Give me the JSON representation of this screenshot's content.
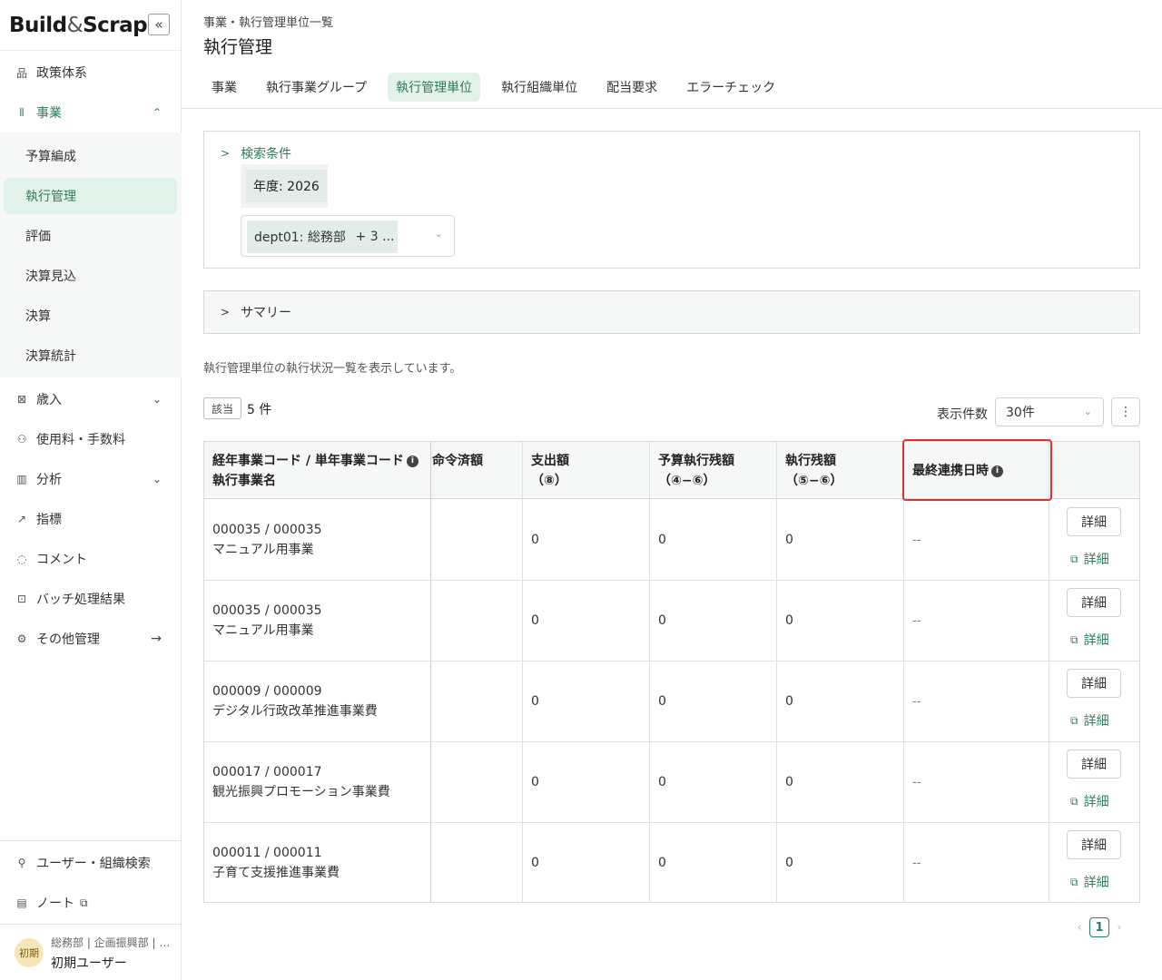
{
  "app": {
    "logo_main": "Build",
    "logo_amp": "&",
    "logo_end": "Scrap",
    "collapse_icon": "«"
  },
  "sidebar": {
    "items": [
      {
        "label": "政策体系",
        "icon": "品"
      },
      {
        "label": "事業",
        "icon": "⫴"
      },
      {
        "label": "歳入",
        "icon": "⊠"
      },
      {
        "label": "使用料・手数料",
        "icon": "⚇"
      },
      {
        "label": "分析",
        "icon": "▥"
      },
      {
        "label": "指標",
        "icon": "↗"
      },
      {
        "label": "コメント",
        "icon": "◌"
      },
      {
        "label": "バッチ処理結果",
        "icon": "⊡"
      },
      {
        "label": "その他管理",
        "icon": "⚙"
      }
    ],
    "sub_items": [
      "予算編成",
      "執行管理",
      "評価",
      "決算見込",
      "決算",
      "決算統計"
    ],
    "bottom": [
      {
        "label": "ユーザー・組織検索",
        "icon": "⚲"
      },
      {
        "label": "ノート",
        "icon": "▤"
      }
    ],
    "user": {
      "avatar": "初期",
      "org": "総務部 | 企画振興部 | …",
      "name": "初期ユーザー"
    }
  },
  "header": {
    "breadcrumb": "事業・執行管理単位一覧",
    "title": "執行管理"
  },
  "tabs": [
    "事業",
    "執行事業グループ",
    "執行管理単位",
    "執行組織単位",
    "配当要求",
    "エラーチェック"
  ],
  "search": {
    "title": "検索条件",
    "year_chip": "年度: 2026",
    "dept_chip": "dept01: 総務部",
    "more_chip": "+ 3 ..."
  },
  "summary": {
    "title": "サマリー"
  },
  "list": {
    "description": "執行管理単位の執行状況一覧を表示しています。",
    "count_badge": "該当",
    "count_text": "5 件",
    "per_page_label": "表示件数",
    "per_page_value": "30件"
  },
  "table": {
    "headers": {
      "code_line1": "経年事業コード / 単年事業コード",
      "code_line2": "執行事業名",
      "order": "命令済額",
      "spend_line1": "支出額",
      "spend_line2": "（⑧）",
      "budget_line1": "予算執行残額",
      "budget_line2": "（④−⑥）",
      "exec_line1": "執行残額",
      "exec_line2": "（⑤−⑥）",
      "last_sync": "最終連携日時"
    },
    "rows": [
      {
        "code": "000035 / 000035",
        "name": "マニュアル用事業",
        "spend": "0",
        "budget_rem": "0",
        "exec_rem": "0",
        "last_sync": "--",
        "btn": "詳細",
        "link": "詳細"
      },
      {
        "code": "000035 / 000035",
        "name": "マニュアル用事業",
        "spend": "0",
        "budget_rem": "0",
        "exec_rem": "0",
        "last_sync": "--",
        "btn": "詳細",
        "link": "詳細"
      },
      {
        "code": "000009 / 000009",
        "name": "デジタル行政改革推進事業費",
        "spend": "0",
        "budget_rem": "0",
        "exec_rem": "0",
        "last_sync": "--",
        "btn": "詳細",
        "link": "詳細"
      },
      {
        "code": "000017 / 000017",
        "name": "観光振興プロモーション事業費",
        "spend": "0",
        "budget_rem": "0",
        "exec_rem": "0",
        "last_sync": "--",
        "btn": "詳細",
        "link": "詳細"
      },
      {
        "code": "000011 / 000011",
        "name": "子育て支援推進事業費",
        "spend": "0",
        "budget_rem": "0",
        "exec_rem": "0",
        "last_sync": "--",
        "btn": "詳細",
        "link": "詳細"
      }
    ]
  },
  "pagination": {
    "current": "1",
    "prev": "‹",
    "next": "›"
  },
  "colors": {
    "accent": "#2e7d5b",
    "accent_bg": "#e2f1ea",
    "highlight": "#e03131"
  }
}
